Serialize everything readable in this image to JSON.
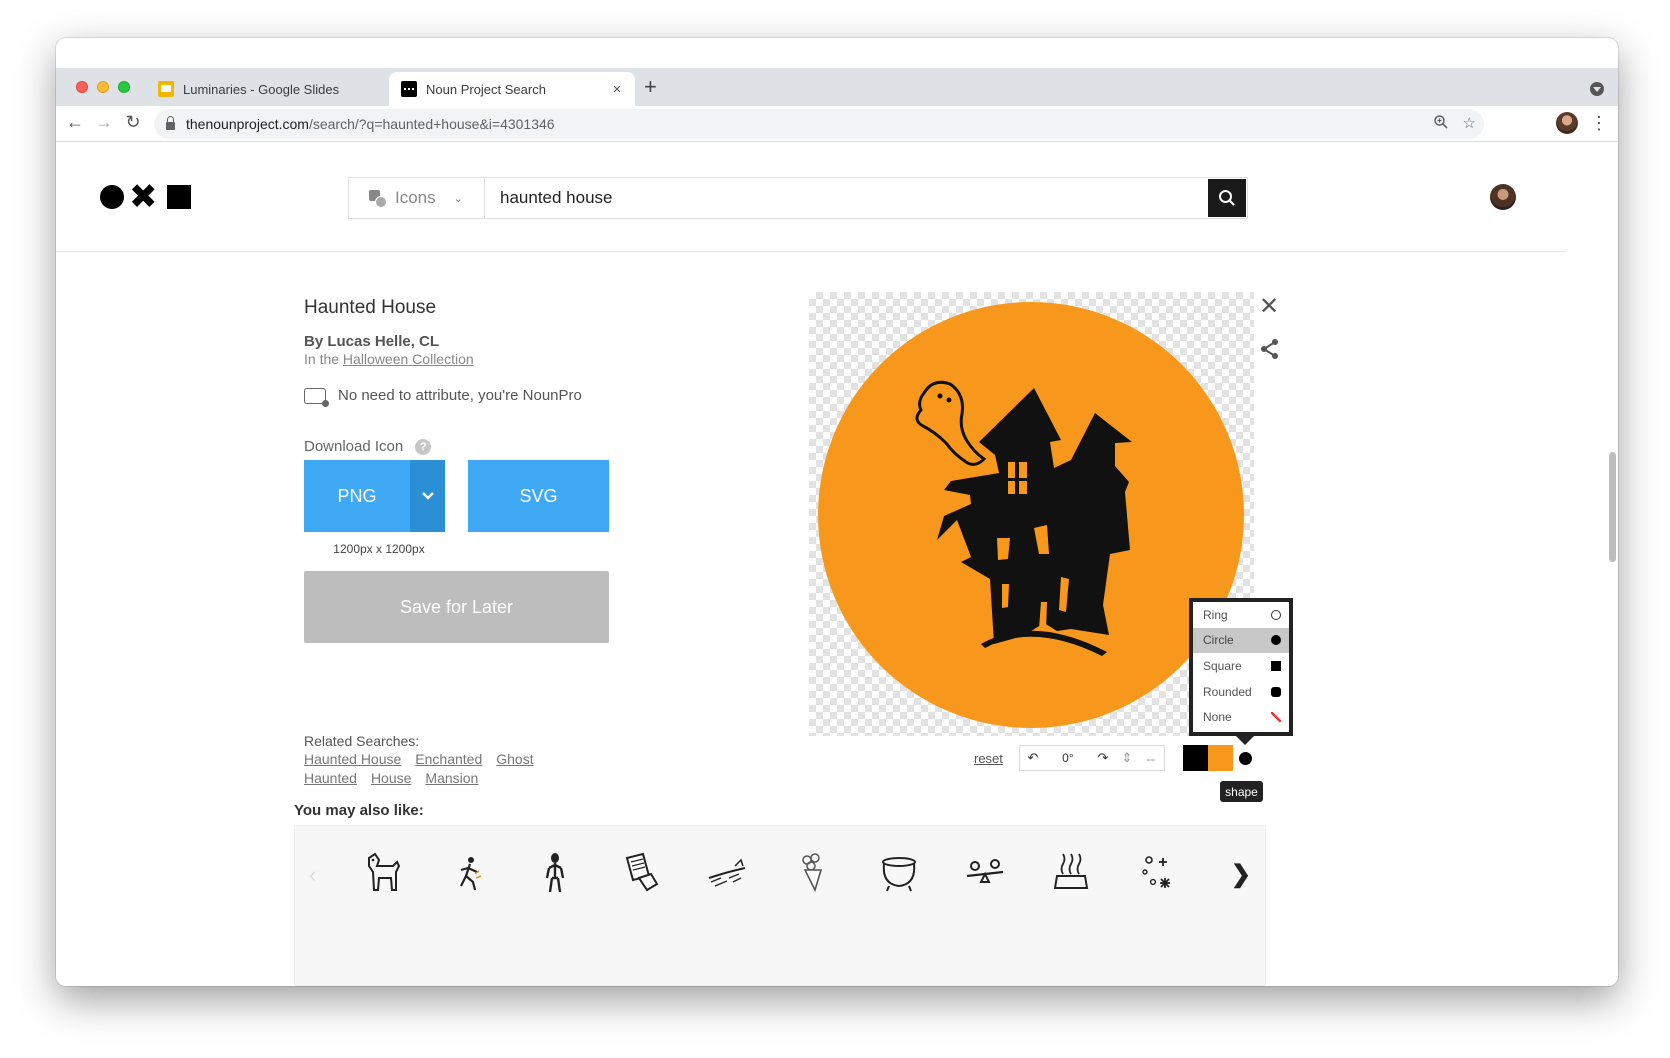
{
  "browser": {
    "tabs": [
      {
        "label": "Luminaries - Google Slides",
        "close": "×"
      },
      {
        "label": "Noun Project Search",
        "close": "×"
      }
    ],
    "new_tab": "+",
    "url_host": "thenounproject.com",
    "url_path": "/search/?q=haunted+house&i=4301346"
  },
  "header": {
    "search_type": "Icons",
    "search_query": "haunted house"
  },
  "icon": {
    "title": "Haunted House",
    "byline": "By Lucas Helle, CL",
    "collection_prefix": "In the ",
    "collection_link": "Halloween Collection",
    "attribution_note": "No need to attribute, you're NounPro"
  },
  "download": {
    "label": "Download Icon",
    "help": "?",
    "png_label": "PNG",
    "svg_label": "SVG",
    "png_size": "1200px x 1200px",
    "save_label": "Save for Later"
  },
  "related": {
    "heading": "Related Searches:",
    "links": [
      "Haunted House",
      "Enchanted",
      "Ghost",
      "Haunted",
      "House",
      "Mansion"
    ]
  },
  "also_like": {
    "heading": "You may also like:",
    "items": [
      "dog-icon",
      "runner-icon",
      "alien-icon",
      "paper-hand-icon",
      "witch-broom-icon",
      "bouquet-icon",
      "cauldron-icon",
      "gender-seesaw-icon",
      "steam-icon",
      "sparkles-icon"
    ]
  },
  "editor": {
    "reset": "reset",
    "rotation": "0°",
    "colors": {
      "foreground": "#000000",
      "background": "#f7981d",
      "shape": "#000000"
    },
    "shape_options": [
      {
        "label": "Ring",
        "indicator": "ring"
      },
      {
        "label": "Circle",
        "indicator": "circle"
      },
      {
        "label": "Square",
        "indicator": "square"
      },
      {
        "label": "Rounded",
        "indicator": "rounded"
      },
      {
        "label": "None",
        "indicator": "none"
      }
    ],
    "selected_shape": "Circle",
    "tooltip": "shape"
  }
}
